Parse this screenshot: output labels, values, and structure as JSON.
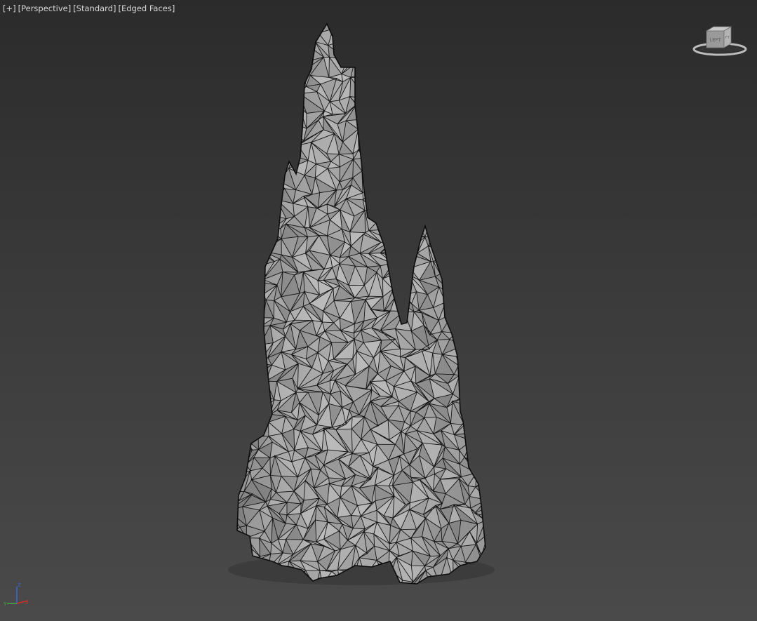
{
  "viewport": {
    "labels": {
      "menu": "[+]",
      "view": "[Perspective]",
      "shading": "[Standard]",
      "display": "[Edged Faces]"
    },
    "background_top": "#2b2b2b",
    "background_bottom": "#4a4a4a"
  },
  "viewcube": {
    "face_left": "LEFT",
    "face_front": "FT",
    "icon": "viewcube-icon"
  },
  "axis_tripod": {
    "z_label": "Z",
    "x_label": "X",
    "y_label": "Y",
    "colors": {
      "x": "#d0302a",
      "y": "#3cb043",
      "z": "#3a66d8"
    }
  },
  "model": {
    "name": "rock-spire-mesh",
    "fill": "#a6a6a6",
    "edge": "#111111"
  }
}
